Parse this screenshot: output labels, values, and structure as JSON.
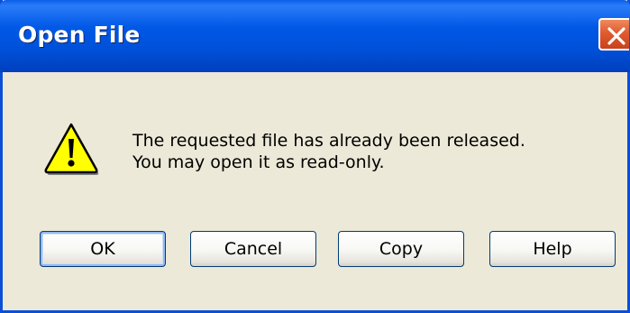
{
  "window": {
    "title": "Open File"
  },
  "message": {
    "line1": "The requested file has already been released.",
    "line2": "You may open it as read-only."
  },
  "buttons": {
    "ok": "OK",
    "cancel": "Cancel",
    "copy": "Copy",
    "help": "Help"
  },
  "icons": {
    "warning": "warning-icon",
    "close": "close-icon"
  },
  "colors": {
    "title_bar": "#0058e6",
    "dialog_background": "#ece9d8",
    "close_button": "#e05b2f",
    "warning_fill": "#ffff00"
  }
}
